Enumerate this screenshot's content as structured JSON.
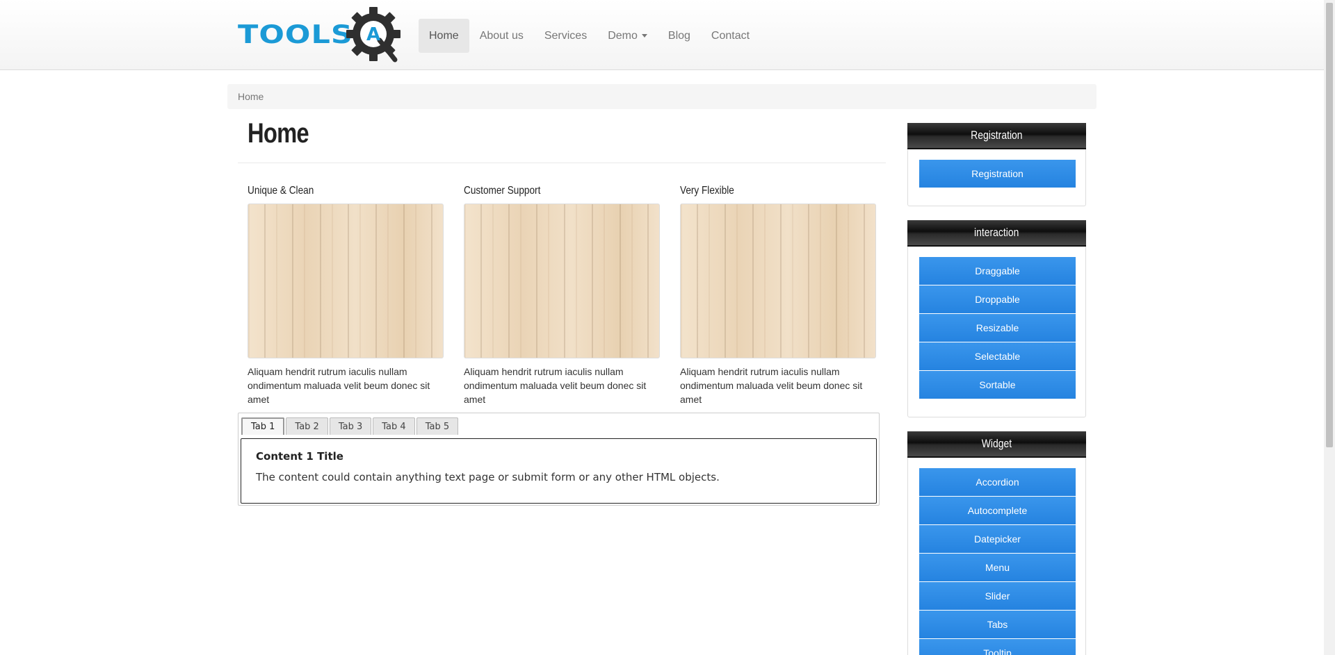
{
  "logo": {
    "text": "TOOLS",
    "badge_letter": "A",
    "brand_color": "#1b9ad6",
    "gear_color": "#2f2f2f"
  },
  "nav": {
    "items": [
      {
        "label": "Home",
        "active": true
      },
      {
        "label": "About us"
      },
      {
        "label": "Services"
      },
      {
        "label": "Demo",
        "dropdown": true
      },
      {
        "label": "Blog"
      },
      {
        "label": "Contact"
      }
    ]
  },
  "breadcrumb": {
    "current": "Home"
  },
  "main": {
    "title": "Home",
    "features": [
      {
        "title": "Unique & Clean",
        "text": "Aliquam hendrit rutrum iaculis nullam ondimentum maluada velit beum donec sit amet"
      },
      {
        "title": "Customer Support",
        "text": "Aliquam hendrit rutrum iaculis nullam ondimentum maluada velit beum donec sit amet"
      },
      {
        "title": "Very Flexible",
        "text": "Aliquam hendrit rutrum iaculis nullam ondimentum maluada velit beum donec sit amet"
      }
    ],
    "tabs": [
      {
        "label": "Tab 1",
        "active": true
      },
      {
        "label": "Tab 2"
      },
      {
        "label": "Tab 3"
      },
      {
        "label": "Tab 4"
      },
      {
        "label": "Tab 5"
      }
    ],
    "panel": {
      "title": "Content 1 Title",
      "text": "The content could contain anything text page or submit form or any other HTML objects."
    }
  },
  "sidebar": {
    "registration": {
      "heading": "Registration",
      "buttons": [
        "Registration"
      ]
    },
    "interaction": {
      "heading": "interaction",
      "buttons": [
        "Draggable",
        "Droppable",
        "Resizable",
        "Selectable",
        "Sortable"
      ]
    },
    "widget": {
      "heading": "Widget",
      "buttons": [
        "Accordion",
        "Autocomplete",
        "Datepicker",
        "Menu",
        "Slider",
        "Tabs",
        "Tooltip"
      ]
    }
  },
  "colors": {
    "button_blue": "#2b8ae6",
    "widget_header": "#1a1a1a",
    "breadcrumb_bg": "#f5f5f5"
  }
}
